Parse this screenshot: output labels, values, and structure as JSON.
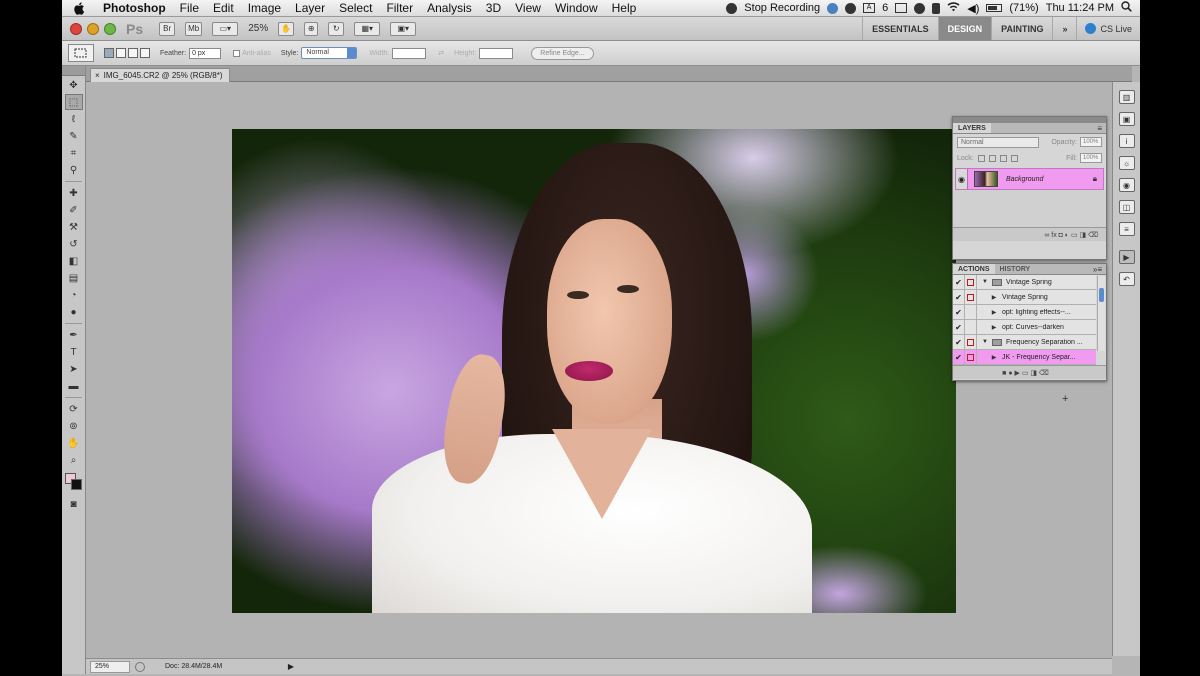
{
  "menubar": {
    "apple_icon": "apple-icon",
    "app_name": "Photoshop",
    "menus": [
      "File",
      "Edit",
      "Image",
      "Layer",
      "Select",
      "Filter",
      "Analysis",
      "3D",
      "View",
      "Window",
      "Help"
    ],
    "stop_recording": "Stop Recording",
    "battery": "(71%)",
    "clock": "Thu 11:24 PM",
    "status_number": "6"
  },
  "appbar": {
    "logo": "Ps",
    "zoom": "25%",
    "workspaces": [
      "ESSENTIALS",
      "DESIGN",
      "PAINTING"
    ],
    "active_workspace": "DESIGN",
    "more": "»",
    "cs_live": "CS Live"
  },
  "options": {
    "feather_label": "Feather:",
    "feather_value": "0 px",
    "anti_alias_label": "Anti-alias",
    "style_label": "Style:",
    "style_value": "Normal",
    "width_label": "Width:",
    "height_label": "Height:",
    "refine_edge": "Refine Edge..."
  },
  "document": {
    "tab_title": "IMG_6045.CR2 @ 25% (RGB/8*)",
    "close": "×"
  },
  "status": {
    "zoom": "25%",
    "doc_size": "Doc: 28.4M/28.4M",
    "arrow": "▶"
  },
  "layers_panel": {
    "tab": "LAYERS",
    "blend_mode": "Normal",
    "opacity_label": "Opacity:",
    "opacity_value": "100%",
    "lock_label": "Lock:",
    "fill_label": "Fill:",
    "fill_value": "100%",
    "layer_name": "Background",
    "footer_icons": "∞   fx   ◘   ◐   ▭   ◨   ⌫"
  },
  "actions_panel": {
    "tabs": [
      "ACTIONS",
      "HISTORY"
    ],
    "active_tab": "ACTIONS",
    "rows": [
      {
        "name": "Vintage Spring",
        "type": "set",
        "dialog": true
      },
      {
        "name": "Vintage Spring",
        "type": "action",
        "dialog": true
      },
      {
        "name": "opt: lighting effects--...",
        "type": "action",
        "dialog": false
      },
      {
        "name": "opt: Curves--darken",
        "type": "action",
        "dialog": false
      },
      {
        "name": "Frequency Separation ...",
        "type": "set",
        "dialog": true
      },
      {
        "name": "JK - Frequency Separ...",
        "type": "action",
        "dialog": true,
        "selected": true
      }
    ],
    "footer_icons": "■   ●   ▶   ▭   ◨   ⌫"
  },
  "colors": {
    "foreground": "#f0c8d9",
    "background": "#111111",
    "selection_highlight": "#f09af0",
    "workspace_active": "#8a8a8a"
  }
}
